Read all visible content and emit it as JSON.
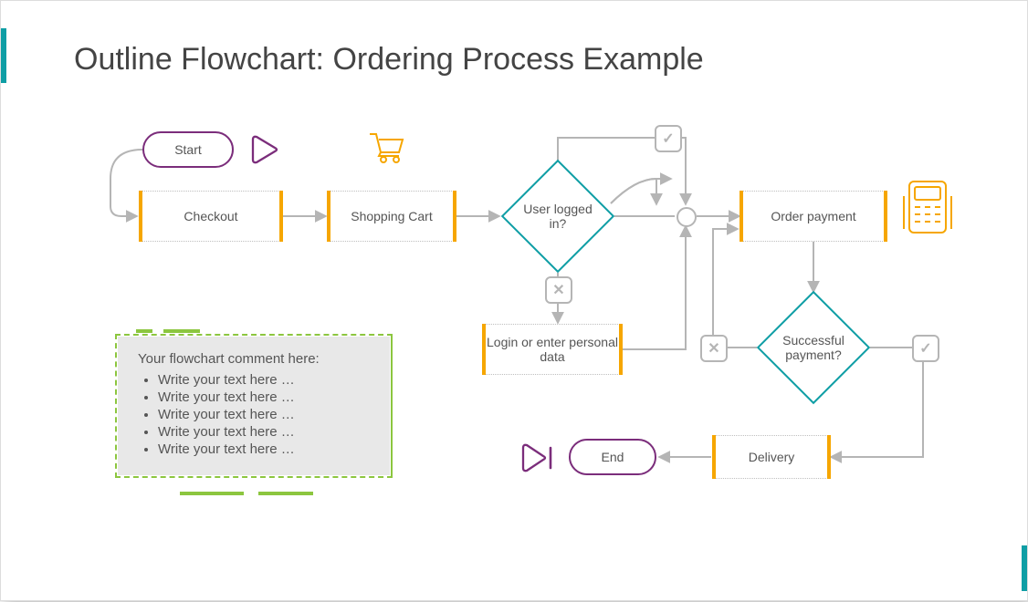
{
  "title": "Outline Flowchart: Ordering Process Example",
  "nodes": {
    "start": "Start",
    "checkout": "Checkout",
    "shopping_cart": "Shopping Cart",
    "user_logged": "User logged in?",
    "login_personal": "Login or enter personal data",
    "order_payment": "Order payment",
    "successful_payment": "Successful payment?",
    "delivery": "Delivery",
    "end": "End"
  },
  "comment": {
    "header": "Your flowchart comment here:",
    "lines": [
      "Write your text here …",
      "Write your text here …",
      "Write your text here …",
      "Write your text here …",
      "Write your text here …"
    ]
  },
  "chart_data": {
    "type": "flowchart",
    "title": "Outline Flowchart: Ordering Process Example",
    "nodes": [
      {
        "id": "start",
        "type": "terminator",
        "label": "Start"
      },
      {
        "id": "checkout",
        "type": "process",
        "label": "Checkout"
      },
      {
        "id": "cart",
        "type": "process",
        "label": "Shopping Cart"
      },
      {
        "id": "logged",
        "type": "decision",
        "label": "User logged in?"
      },
      {
        "id": "login",
        "type": "process",
        "label": "Login or enter personal data"
      },
      {
        "id": "join",
        "type": "junction",
        "label": ""
      },
      {
        "id": "order",
        "type": "process",
        "label": "Order payment"
      },
      {
        "id": "pay",
        "type": "decision",
        "label": "Successful payment?"
      },
      {
        "id": "delivery",
        "type": "process",
        "label": "Delivery"
      },
      {
        "id": "end",
        "type": "terminator",
        "label": "End"
      }
    ],
    "edges": [
      {
        "from": "start",
        "to": "checkout"
      },
      {
        "from": "checkout",
        "to": "cart"
      },
      {
        "from": "cart",
        "to": "logged"
      },
      {
        "from": "logged",
        "to": "join",
        "label": "yes"
      },
      {
        "from": "logged",
        "to": "login",
        "label": "no"
      },
      {
        "from": "login",
        "to": "join"
      },
      {
        "from": "join",
        "to": "order"
      },
      {
        "from": "order",
        "to": "pay"
      },
      {
        "from": "pay",
        "to": "order",
        "label": "no"
      },
      {
        "from": "pay",
        "to": "delivery",
        "label": "yes"
      },
      {
        "from": "delivery",
        "to": "end"
      }
    ]
  }
}
